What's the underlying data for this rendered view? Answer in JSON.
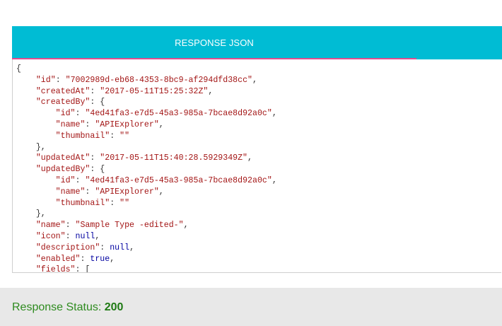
{
  "tabs": [
    {
      "label": "RESPONSE JSON",
      "active": true
    }
  ],
  "colors": {
    "tab_bar": "#00bcd4",
    "tab_indicator": "#e04d8f",
    "json_key": "#a31515",
    "json_string": "#a31515",
    "json_keyword": "#0000a0",
    "status_text": "#2e8b1f",
    "status_bar_bg": "#e8e8e8"
  },
  "json_lines": [
    [
      {
        "t": "p",
        "v": "{"
      }
    ],
    [
      {
        "t": "p",
        "v": "    "
      },
      {
        "t": "k",
        "v": "\"id\""
      },
      {
        "t": "p",
        "v": ": "
      },
      {
        "t": "s",
        "v": "\"7002989d-eb68-4353-8bc9-af294dfd38cc\""
      },
      {
        "t": "p",
        "v": ","
      }
    ],
    [
      {
        "t": "p",
        "v": "    "
      },
      {
        "t": "k",
        "v": "\"createdAt\""
      },
      {
        "t": "p",
        "v": ": "
      },
      {
        "t": "s",
        "v": "\"2017-05-11T15:25:32Z\""
      },
      {
        "t": "p",
        "v": ","
      }
    ],
    [
      {
        "t": "p",
        "v": "    "
      },
      {
        "t": "k",
        "v": "\"createdBy\""
      },
      {
        "t": "p",
        "v": ": {"
      }
    ],
    [
      {
        "t": "p",
        "v": "        "
      },
      {
        "t": "k",
        "v": "\"id\""
      },
      {
        "t": "p",
        "v": ": "
      },
      {
        "t": "s",
        "v": "\"4ed41fa3-e7d5-45a3-985a-7bcae8d92a0c\""
      },
      {
        "t": "p",
        "v": ","
      }
    ],
    [
      {
        "t": "p",
        "v": "        "
      },
      {
        "t": "k",
        "v": "\"name\""
      },
      {
        "t": "p",
        "v": ": "
      },
      {
        "t": "s",
        "v": "\"APIExplorer\""
      },
      {
        "t": "p",
        "v": ","
      }
    ],
    [
      {
        "t": "p",
        "v": "        "
      },
      {
        "t": "k",
        "v": "\"thumbnail\""
      },
      {
        "t": "p",
        "v": ": "
      },
      {
        "t": "s",
        "v": "\"\""
      }
    ],
    [
      {
        "t": "p",
        "v": "    },"
      }
    ],
    [
      {
        "t": "p",
        "v": "    "
      },
      {
        "t": "k",
        "v": "\"updatedAt\""
      },
      {
        "t": "p",
        "v": ": "
      },
      {
        "t": "s",
        "v": "\"2017-05-11T15:40:28.5929349Z\""
      },
      {
        "t": "p",
        "v": ","
      }
    ],
    [
      {
        "t": "p",
        "v": "    "
      },
      {
        "t": "k",
        "v": "\"updatedBy\""
      },
      {
        "t": "p",
        "v": ": {"
      }
    ],
    [
      {
        "t": "p",
        "v": "        "
      },
      {
        "t": "k",
        "v": "\"id\""
      },
      {
        "t": "p",
        "v": ": "
      },
      {
        "t": "s",
        "v": "\"4ed41fa3-e7d5-45a3-985a-7bcae8d92a0c\""
      },
      {
        "t": "p",
        "v": ","
      }
    ],
    [
      {
        "t": "p",
        "v": "        "
      },
      {
        "t": "k",
        "v": "\"name\""
      },
      {
        "t": "p",
        "v": ": "
      },
      {
        "t": "s",
        "v": "\"APIExplorer\""
      },
      {
        "t": "p",
        "v": ","
      }
    ],
    [
      {
        "t": "p",
        "v": "        "
      },
      {
        "t": "k",
        "v": "\"thumbnail\""
      },
      {
        "t": "p",
        "v": ": "
      },
      {
        "t": "s",
        "v": "\"\""
      }
    ],
    [
      {
        "t": "p",
        "v": "    },"
      }
    ],
    [
      {
        "t": "p",
        "v": "    "
      },
      {
        "t": "k",
        "v": "\"name\""
      },
      {
        "t": "p",
        "v": ": "
      },
      {
        "t": "s",
        "v": "\"Sample Type -edited-\""
      },
      {
        "t": "p",
        "v": ","
      }
    ],
    [
      {
        "t": "p",
        "v": "    "
      },
      {
        "t": "k",
        "v": "\"icon\""
      },
      {
        "t": "p",
        "v": ": "
      },
      {
        "t": "kw",
        "v": "null"
      },
      {
        "t": "p",
        "v": ","
      }
    ],
    [
      {
        "t": "p",
        "v": "    "
      },
      {
        "t": "k",
        "v": "\"description\""
      },
      {
        "t": "p",
        "v": ": "
      },
      {
        "t": "kw",
        "v": "null"
      },
      {
        "t": "p",
        "v": ","
      }
    ],
    [
      {
        "t": "p",
        "v": "    "
      },
      {
        "t": "k",
        "v": "\"enabled\""
      },
      {
        "t": "p",
        "v": ": "
      },
      {
        "t": "kw",
        "v": "true"
      },
      {
        "t": "p",
        "v": ","
      }
    ],
    [
      {
        "t": "p",
        "v": "    "
      },
      {
        "t": "k",
        "v": "\"fields\""
      },
      {
        "t": "p",
        "v": ": ["
      }
    ]
  ],
  "status": {
    "label": "Response Status: ",
    "code": "200"
  }
}
